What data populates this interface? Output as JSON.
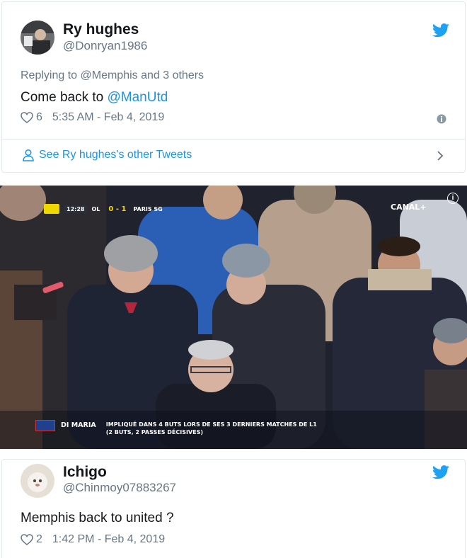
{
  "tweet1": {
    "name": "Ry hughes",
    "handle": "@Donryan1986",
    "replying_prefix": "Replying to ",
    "replying_to": "@Memphis",
    "replying_suffix": " and 3 others",
    "text_before": "Come back to ",
    "mention": "@ManUtd",
    "likes": "6",
    "timestamp": "5:35 AM - Feb 4, 2019"
  },
  "more_tweets": {
    "label": "See Ry hughes's other Tweets"
  },
  "media": {
    "broadcaster": "CANAL+",
    "score": {
      "clock": "12:28",
      "home": "OL",
      "score": "0 - 1",
      "away": "PARIS SG"
    },
    "caption": {
      "player": "DI MARIA",
      "line1": "IMPLIQUÉ DANS 4 BUTS LORS DE SES 3 DERNIERS MATCHES DE L1",
      "line2": "(2 BUTS, 2 PASSES DÉCISIVES)"
    },
    "info_glyph": "i"
  },
  "tweet2": {
    "name": "Ichigo",
    "handle": "@Chinmoy07883267",
    "text": "Memphis back to united ?",
    "likes": "2",
    "timestamp": "1:42 PM - Feb 4, 2019"
  },
  "colors": {
    "twitter_blue": "#1da1f2",
    "link_blue": "#1b95e0",
    "secondary_text": "#657786"
  },
  "icons": {
    "bird": "twitter-bird-icon",
    "heart": "heart-icon",
    "info": "info-icon",
    "person": "person-icon",
    "chevron": "chevron-right-icon"
  }
}
